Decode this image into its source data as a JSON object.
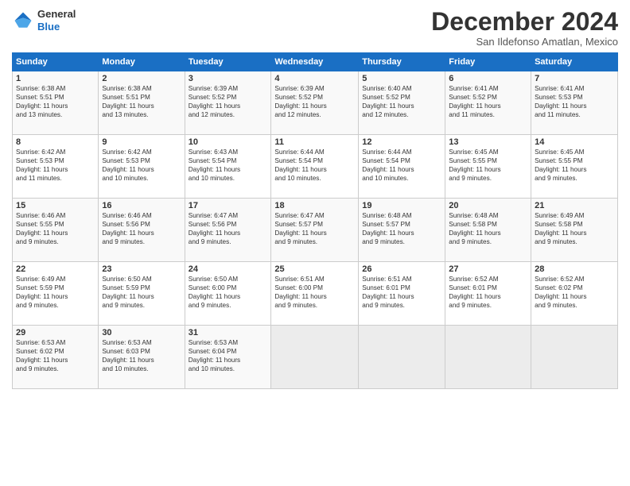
{
  "header": {
    "logo_general": "General",
    "logo_blue": "Blue",
    "title": "December 2024",
    "subtitle": "San Ildefonso Amatlan, Mexico"
  },
  "days_of_week": [
    "Sunday",
    "Monday",
    "Tuesday",
    "Wednesday",
    "Thursday",
    "Friday",
    "Saturday"
  ],
  "weeks": [
    [
      {
        "day": "1",
        "info": "Sunrise: 6:38 AM\nSunset: 5:51 PM\nDaylight: 11 hours\nand 13 minutes."
      },
      {
        "day": "2",
        "info": "Sunrise: 6:38 AM\nSunset: 5:51 PM\nDaylight: 11 hours\nand 13 minutes."
      },
      {
        "day": "3",
        "info": "Sunrise: 6:39 AM\nSunset: 5:52 PM\nDaylight: 11 hours\nand 12 minutes."
      },
      {
        "day": "4",
        "info": "Sunrise: 6:39 AM\nSunset: 5:52 PM\nDaylight: 11 hours\nand 12 minutes."
      },
      {
        "day": "5",
        "info": "Sunrise: 6:40 AM\nSunset: 5:52 PM\nDaylight: 11 hours\nand 12 minutes."
      },
      {
        "day": "6",
        "info": "Sunrise: 6:41 AM\nSunset: 5:52 PM\nDaylight: 11 hours\nand 11 minutes."
      },
      {
        "day": "7",
        "info": "Sunrise: 6:41 AM\nSunset: 5:53 PM\nDaylight: 11 hours\nand 11 minutes."
      }
    ],
    [
      {
        "day": "8",
        "info": "Sunrise: 6:42 AM\nSunset: 5:53 PM\nDaylight: 11 hours\nand 11 minutes."
      },
      {
        "day": "9",
        "info": "Sunrise: 6:42 AM\nSunset: 5:53 PM\nDaylight: 11 hours\nand 10 minutes."
      },
      {
        "day": "10",
        "info": "Sunrise: 6:43 AM\nSunset: 5:54 PM\nDaylight: 11 hours\nand 10 minutes."
      },
      {
        "day": "11",
        "info": "Sunrise: 6:44 AM\nSunset: 5:54 PM\nDaylight: 11 hours\nand 10 minutes."
      },
      {
        "day": "12",
        "info": "Sunrise: 6:44 AM\nSunset: 5:54 PM\nDaylight: 11 hours\nand 10 minutes."
      },
      {
        "day": "13",
        "info": "Sunrise: 6:45 AM\nSunset: 5:55 PM\nDaylight: 11 hours\nand 9 minutes."
      },
      {
        "day": "14",
        "info": "Sunrise: 6:45 AM\nSunset: 5:55 PM\nDaylight: 11 hours\nand 9 minutes."
      }
    ],
    [
      {
        "day": "15",
        "info": "Sunrise: 6:46 AM\nSunset: 5:55 PM\nDaylight: 11 hours\nand 9 minutes."
      },
      {
        "day": "16",
        "info": "Sunrise: 6:46 AM\nSunset: 5:56 PM\nDaylight: 11 hours\nand 9 minutes."
      },
      {
        "day": "17",
        "info": "Sunrise: 6:47 AM\nSunset: 5:56 PM\nDaylight: 11 hours\nand 9 minutes."
      },
      {
        "day": "18",
        "info": "Sunrise: 6:47 AM\nSunset: 5:57 PM\nDaylight: 11 hours\nand 9 minutes."
      },
      {
        "day": "19",
        "info": "Sunrise: 6:48 AM\nSunset: 5:57 PM\nDaylight: 11 hours\nand 9 minutes."
      },
      {
        "day": "20",
        "info": "Sunrise: 6:48 AM\nSunset: 5:58 PM\nDaylight: 11 hours\nand 9 minutes."
      },
      {
        "day": "21",
        "info": "Sunrise: 6:49 AM\nSunset: 5:58 PM\nDaylight: 11 hours\nand 9 minutes."
      }
    ],
    [
      {
        "day": "22",
        "info": "Sunrise: 6:49 AM\nSunset: 5:59 PM\nDaylight: 11 hours\nand 9 minutes."
      },
      {
        "day": "23",
        "info": "Sunrise: 6:50 AM\nSunset: 5:59 PM\nDaylight: 11 hours\nand 9 minutes."
      },
      {
        "day": "24",
        "info": "Sunrise: 6:50 AM\nSunset: 6:00 PM\nDaylight: 11 hours\nand 9 minutes."
      },
      {
        "day": "25",
        "info": "Sunrise: 6:51 AM\nSunset: 6:00 PM\nDaylight: 11 hours\nand 9 minutes."
      },
      {
        "day": "26",
        "info": "Sunrise: 6:51 AM\nSunset: 6:01 PM\nDaylight: 11 hours\nand 9 minutes."
      },
      {
        "day": "27",
        "info": "Sunrise: 6:52 AM\nSunset: 6:01 PM\nDaylight: 11 hours\nand 9 minutes."
      },
      {
        "day": "28",
        "info": "Sunrise: 6:52 AM\nSunset: 6:02 PM\nDaylight: 11 hours\nand 9 minutes."
      }
    ],
    [
      {
        "day": "29",
        "info": "Sunrise: 6:53 AM\nSunset: 6:02 PM\nDaylight: 11 hours\nand 9 minutes."
      },
      {
        "day": "30",
        "info": "Sunrise: 6:53 AM\nSunset: 6:03 PM\nDaylight: 11 hours\nand 10 minutes."
      },
      {
        "day": "31",
        "info": "Sunrise: 6:53 AM\nSunset: 6:04 PM\nDaylight: 11 hours\nand 10 minutes."
      },
      {
        "day": "",
        "info": ""
      },
      {
        "day": "",
        "info": ""
      },
      {
        "day": "",
        "info": ""
      },
      {
        "day": "",
        "info": ""
      }
    ]
  ]
}
